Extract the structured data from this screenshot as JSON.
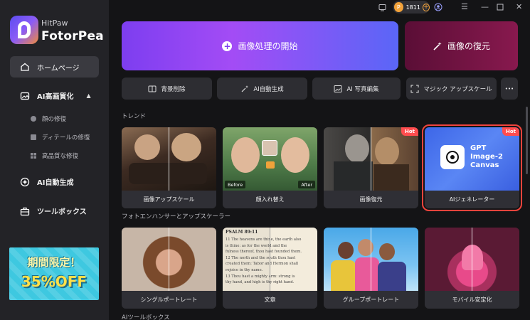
{
  "app": {
    "brand_small": "HitPaw",
    "brand_large": "FotorPea"
  },
  "sidebar": {
    "home": "ホームページ",
    "ai_enhance": "AI高画質化",
    "sub_items": [
      "顔の修復",
      "ディテールの修復",
      "高品質な修復"
    ],
    "ai_generate": "AI自動生成",
    "toolbox": "ツールボックス",
    "promo_line1": "期間限定！",
    "promo_line2": "35%OFF"
  },
  "titlebar": {
    "credits": "1811"
  },
  "hero": {
    "start_label": "画像処理の開始",
    "restore_label": "画像の復元"
  },
  "tools": {
    "bg_remove": "背景削除",
    "ai_generate": "AI自動生成",
    "ai_photo_edit": "AI 写真編集",
    "magic_upscale": "マジック アップスケール",
    "more": "•••"
  },
  "sections": {
    "trend": "トレンド",
    "enhancer": "フォトエンハンサーとアップスケーラー",
    "ai_toolbox": "AIツールボックス"
  },
  "trend_cards": [
    {
      "caption": "画像アップスケール"
    },
    {
      "caption": "顔入れ替え",
      "before": "Before",
      "after": "After"
    },
    {
      "caption": "画像復元",
      "badge": "Hot"
    },
    {
      "caption": "AIジェネレーター",
      "badge": "Hot",
      "text1": "GPT",
      "text2": "Image-2",
      "text3": "Canvas"
    }
  ],
  "enhancer_cards": [
    {
      "caption": "シングルポートレート"
    },
    {
      "caption": "文章",
      "doc_header": "PSALM 89:11",
      "doc_lines": [
        "11 The heavens are thine, the earth also",
        "is thine: as for the world and the",
        "fulness thereof, thou hast founded them.",
        "12 The north and the south thou hast",
        "created them: Tabor and Hermon shall",
        "rejoice in thy name.",
        "13 Thou hast a mighty arm: strong is",
        "thy hand, and high is thy right hand."
      ]
    },
    {
      "caption": "グループポートレート"
    },
    {
      "caption": "モバイル安定化"
    }
  ],
  "colors": {
    "accent_purple": "#7d3ef0",
    "hot_badge": "#ff4d4f",
    "selected_outline": "#f0443c",
    "coin": "#f2a23a"
  }
}
